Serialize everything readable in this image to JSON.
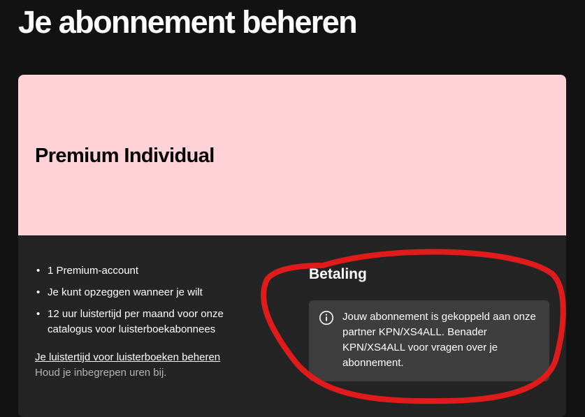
{
  "page": {
    "title": "Je abonnement beheren"
  },
  "plan": {
    "name": "Premium Individual",
    "header_color": "#ffd2d7",
    "features": [
      "1 Premium-account",
      "Je kunt opzeggen wanneer je wilt",
      "12 uur luistertijd per maand voor onze catalogus voor luisterboekabonnees"
    ],
    "manage_link": "Je luistertijd voor luisterboeken beheren",
    "manage_hint": "Houd je inbegrepen uren bij."
  },
  "payment": {
    "title": "Betaling",
    "notice_icon": "info-icon",
    "notice": "Jouw abonnement is gekoppeld aan onze partner KPN/XS4ALL. Benader KPN/XS4ALL voor vragen over je abonnement."
  },
  "annotation": {
    "color": "#e01b1b"
  },
  "colors": {
    "background": "#121212",
    "card": "#242424",
    "notice_background": "#3e3e3e",
    "muted_text": "#b3b3b3"
  }
}
